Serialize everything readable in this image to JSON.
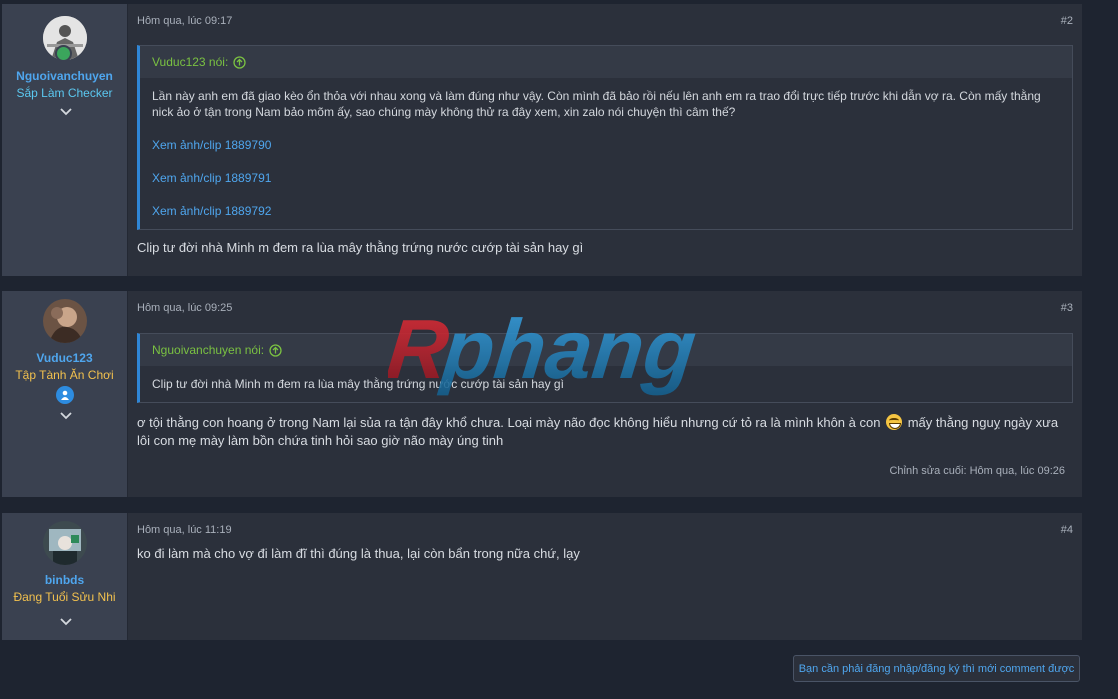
{
  "posts": [
    {
      "author": "Nguoivanchuyen",
      "title": "Sắp Làm Checker",
      "time": "Hôm qua, lúc 09:17",
      "number": "#2",
      "quote": {
        "author": "Vuduc123 nói:",
        "text": "Lần này anh em đã giao kèo ổn thỏa với nhau xong và làm đúng như vậy. Còn mình đã bảo rồi nếu lên anh em ra trao đổi trực tiếp trước khi dẫn vợ ra. Còn mấy thằng nick ảo ở tận trong Nam bảo mõm ấy, sao chúng mày không thử ra đây xem, xin zalo nói chuyện thì câm thế?",
        "links": [
          "Xem ảnh/clip 1889790",
          "Xem ảnh/clip 1889791",
          "Xem ảnh/clip 1889792"
        ]
      },
      "message": "Clip tư đời nhà Minh m đem ra lùa mây thằng trứng nước cướp tài sản hay gì"
    },
    {
      "author": "Vuduc123",
      "title": "Tập Tành Ăn Chơi",
      "time": "Hôm qua, lúc 09:25",
      "number": "#3",
      "quote": {
        "author": "Nguoivanchuyen nói:",
        "text": "Clip tư đời nhà Minh m đem ra lùa mây thằng trứng nước cướp tài sản hay gì"
      },
      "message_part1": "ơ tội thằng con hoang ở trong Nam lại sủa ra tận đây khổ chưa. Loại mày não đọc không hiểu nhưng cứ tỏ ra là mình khôn à con",
      "message_part2": "mấy thằng nguỵ ngày xưa lôi con mẹ mày làm bồn chứa tinh hỏi sao giờ não mày úng tinh",
      "edited": "Chỉnh sửa cuối: Hôm qua, lúc 09:26"
    },
    {
      "author": "binbds",
      "title": "Đang Tuổi Sửu Nhi",
      "time": "Hôm qua, lúc 11:19",
      "number": "#4",
      "message": "ko đi làm mà cho vợ đi làm đĩ thì đúng là thua, lại còn bẩn trong nữa chứ, lạy"
    }
  ],
  "login_prompt": "Bạn cần phải đăng nhập/đăng ký thì mới comment được",
  "watermark": "Rphang",
  "colors": {
    "link": "#4fa6ee",
    "quote_author": "#7ac142",
    "title_cyan": "#5bc8f0",
    "title_yellow": "#f2c14e"
  }
}
